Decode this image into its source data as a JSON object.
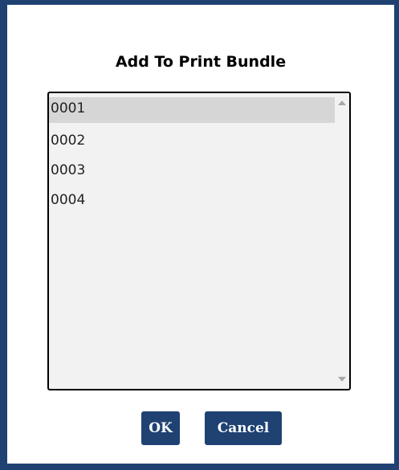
{
  "dialog": {
    "title": "Add To Print Bundle"
  },
  "list": {
    "items": [
      {
        "label": "0001",
        "selected": true
      },
      {
        "label": "0002",
        "selected": false
      },
      {
        "label": "0003",
        "selected": false
      },
      {
        "label": "0004",
        "selected": false
      }
    ]
  },
  "buttons": {
    "ok_label": "OK",
    "cancel_label": "Cancel"
  },
  "colors": {
    "accent": "#1f4273",
    "selection": "#d6d6d6",
    "list_background": "#f2f2f2"
  },
  "icons": {
    "scroll_up": "scroll-up-arrow-icon",
    "scroll_down": "scroll-down-arrow-icon"
  }
}
